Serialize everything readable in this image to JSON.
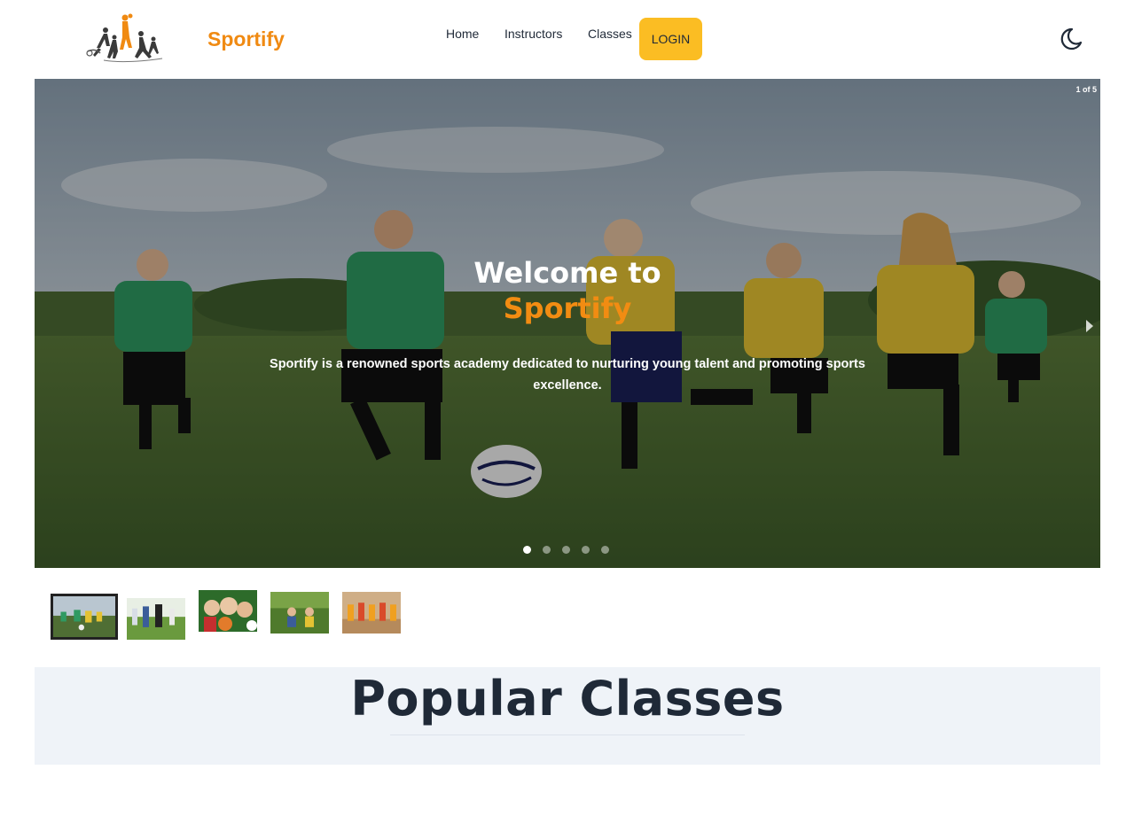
{
  "navbar": {
    "brand": "Sportify",
    "links": [
      "Home",
      "Instructors",
      "Classes"
    ],
    "login_label": "LOGIN",
    "logo_icon": "sports-figures-logo-icon",
    "theme_icon": "moon-icon"
  },
  "hero": {
    "counter": "1 of 5",
    "title_line1": "Welcome to",
    "title_line2": "Sportify",
    "description": "Sportify is a renowned sports academy dedicated to nurturing young talent and promoting sports excellence.",
    "slide_count": 5,
    "active_slide": 1,
    "next_icon": "chevron-right-icon"
  },
  "thumbnails": {
    "count": 5,
    "active_index": 0
  },
  "popular": {
    "title": "Popular Classes"
  },
  "colors": {
    "brand": "#f08a12",
    "login_button": "#fbbd23",
    "section_bg": "#eff3f8",
    "text_dark": "#1f2937"
  }
}
